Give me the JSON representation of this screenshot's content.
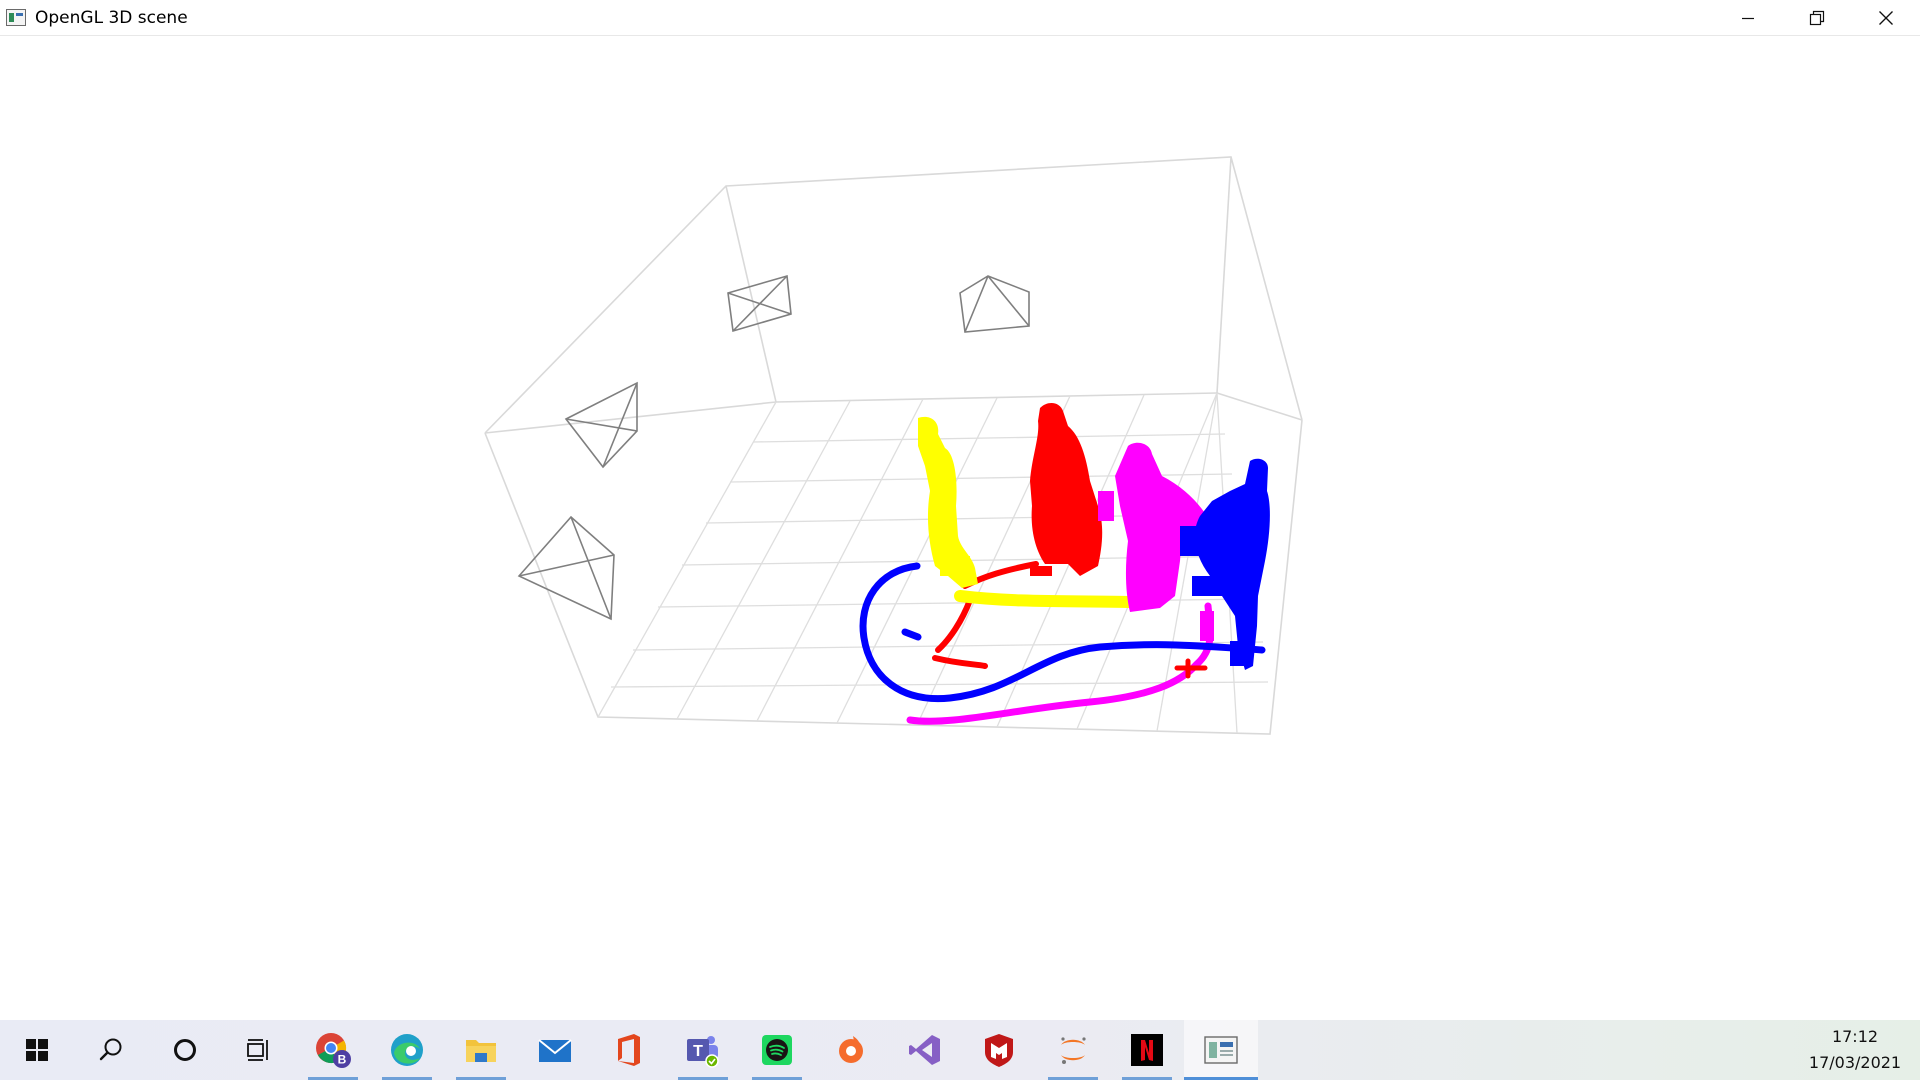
{
  "window": {
    "title": "OpenGL 3D scene",
    "controls": {
      "minimize_icon": "minimize-icon",
      "restore_icon": "restore-icon",
      "close_icon": "close-icon"
    }
  },
  "scene": {
    "background": "#ffffff",
    "grid_color": "#d9d9d9",
    "camera_frustum_color": "#7a7a7a",
    "camera_count": 4,
    "people": [
      {
        "color": "#ffff00",
        "trajectory_color": "#ffff00"
      },
      {
        "color": "#ff0000",
        "trajectory_color": "#ff0000"
      },
      {
        "color": "#ff00ff",
        "trajectory_color": "#ff00ff"
      },
      {
        "color": "#0000ff",
        "trajectory_color": "#0000ff"
      }
    ]
  },
  "taskbar": {
    "start_icon": "windows-start-icon",
    "search_icon": "search-icon",
    "cortana_icon": "cortana-circle-icon",
    "taskview_icon": "task-view-icon",
    "apps": [
      {
        "icon": "chrome-icon",
        "badge": "B",
        "color": "#db4437"
      },
      {
        "icon": "edge-icon",
        "color": "#1fa0c9"
      },
      {
        "icon": "file-explorer-icon",
        "color": "#f2c33c"
      },
      {
        "icon": "mail-icon",
        "color": "#1f73c9"
      },
      {
        "icon": "office-icon",
        "color": "#e3461d"
      },
      {
        "icon": "teams-icon",
        "color": "#5558af"
      },
      {
        "icon": "spotify-icon",
        "color": "#1ed760"
      },
      {
        "icon": "origin-icon",
        "color": "#f56c2d"
      },
      {
        "icon": "visual-studio-icon",
        "color": "#865fc5"
      },
      {
        "icon": "mcafee-icon",
        "color": "#c01818"
      },
      {
        "icon": "jupyter-icon",
        "color": "#f37626"
      },
      {
        "icon": "netflix-icon",
        "color": "#e50914"
      },
      {
        "icon": "opengl-window-icon",
        "color": "#3a6fb0",
        "active": true
      }
    ],
    "clock": {
      "time": "17:12",
      "date": "17/03/2021"
    }
  }
}
